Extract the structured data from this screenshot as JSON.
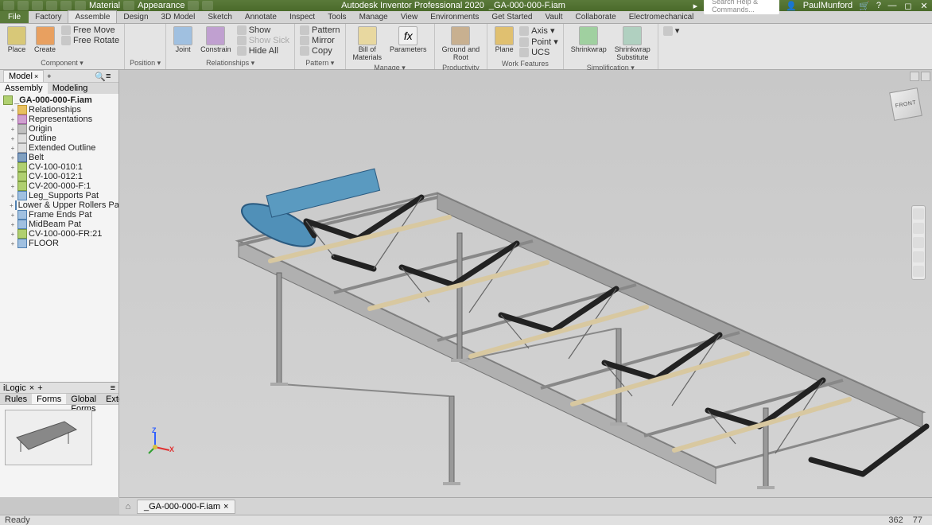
{
  "app": {
    "title": "Autodesk Inventor Professional 2020",
    "document": "_GA-000-000-F.iam",
    "material": "Material",
    "appearance": "Appearance",
    "search_placeholder": "Search Help & Commands...",
    "user": "PaulMunford",
    "status": "Ready",
    "coords": {
      "x": "362",
      "y": "77"
    }
  },
  "tabs": [
    "Factory",
    "Assemble",
    "Design",
    "3D Model",
    "Sketch",
    "Annotate",
    "Inspect",
    "Tools",
    "Manage",
    "View",
    "Environments",
    "Get Started",
    "Vault",
    "Collaborate",
    "Electromechanical"
  ],
  "active_tab": "Assemble",
  "file_tab": "File",
  "ribbon": {
    "component": {
      "label": "Component ▾",
      "place": "Place",
      "create": "Create",
      "free_move": "Free Move",
      "free_rotate": "Free Rotate"
    },
    "position": {
      "label": "Position ▾"
    },
    "relationships": {
      "label": "Relationships ▾",
      "joint": "Joint",
      "constrain": "Constrain",
      "show": "Show",
      "show_sick": "Show Sick",
      "hide_all": "Hide All"
    },
    "pattern": {
      "label": "Pattern ▾",
      "pattern": "Pattern",
      "mirror": "Mirror",
      "copy": "Copy"
    },
    "manage": {
      "label": "Manage ▾",
      "bom": "Bill of\nMaterials",
      "parameters": "Parameters"
    },
    "productivity": {
      "label": "Productivity",
      "ground": "Ground and\nRoot"
    },
    "workfeatures": {
      "label": "Work Features",
      "plane": "Plane",
      "axis": "Axis ▾",
      "point": "Point ▾",
      "ucs": "UCS"
    },
    "simplification": {
      "label": "Simplification ▾",
      "shrinkwrap": "Shrinkwrap",
      "substitute": "Shrinkwrap\nSubstitute"
    }
  },
  "browser": {
    "tab": "Model",
    "subtabs": [
      "Assembly",
      "Modeling"
    ],
    "root": "_GA-000-000-F.iam",
    "items": [
      {
        "label": "Relationships",
        "ico": "folder"
      },
      {
        "label": "Representations",
        "ico": "rep"
      },
      {
        "label": "Origin",
        "ico": "origin"
      },
      {
        "label": "Outline",
        "ico": "outline"
      },
      {
        "label": "Extended Outline",
        "ico": "outline"
      },
      {
        "label": "Belt",
        "ico": "belt"
      },
      {
        "label": "CV-100-010:1",
        "ico": "asm"
      },
      {
        "label": "CV-100-012:1",
        "ico": "asm"
      },
      {
        "label": "CV-200-000-F:1",
        "ico": "asm"
      },
      {
        "label": "Leg_Supports Pat",
        "ico": "part"
      },
      {
        "label": "Lower & Upper Rollers Pat",
        "ico": "part"
      },
      {
        "label": "Frame Ends Pat",
        "ico": "part"
      },
      {
        "label": "MidBeam Pat",
        "ico": "part"
      },
      {
        "label": "CV-100-000-FR:21",
        "ico": "asm"
      },
      {
        "label": "FLOOR",
        "ico": "part"
      }
    ]
  },
  "logic": {
    "title": "iLogic",
    "tabs": [
      "Rules",
      "Forms",
      "Global Forms",
      "External"
    ],
    "active": "Forms"
  },
  "doctab": "_GA-000-000-F.iam",
  "viewcube": "FRONT"
}
